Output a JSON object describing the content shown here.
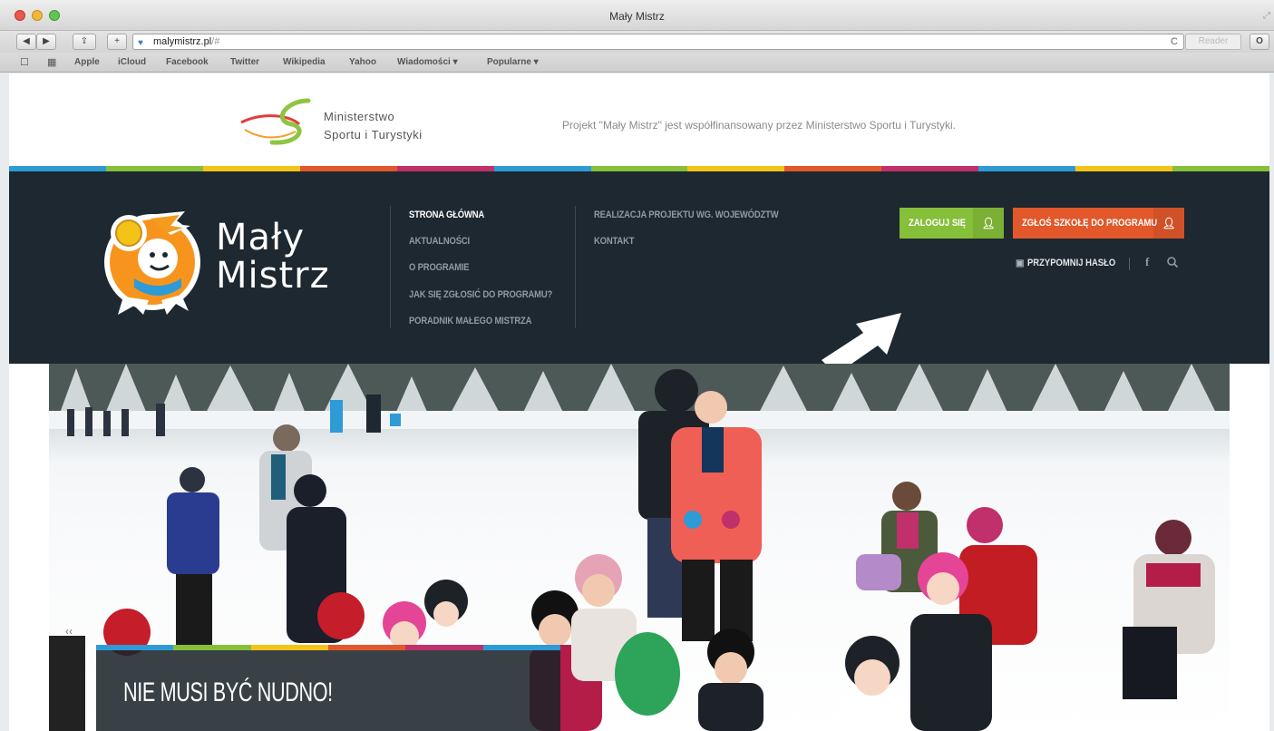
{
  "window": {
    "title": "Mały Mistrz"
  },
  "toolbar": {
    "url_host": "malymistrz.pl",
    "url_hash": "/#",
    "reload_glyph": "C",
    "reader_label": "Reader"
  },
  "bookmarks": [
    "Apple",
    "iCloud",
    "Facebook",
    "Twitter",
    "Wikipedia",
    "Yahoo",
    "Wiadomości ▾",
    "Popularne ▾"
  ],
  "sponsor": {
    "ministry_line1": "Ministerstwo",
    "ministry_line2": "Sportu i Turystyki",
    "cofund_text": "Projekt \"Mały Mistrz\" jest współfinansowany przez Ministerstwo Sportu i Turystyki."
  },
  "brand": {
    "line1": "Mały",
    "line2": "Mistrz"
  },
  "nav": {
    "col1": [
      "Strona główna",
      "Aktualności",
      "O programie",
      "Jak się zgłosić do programu?",
      "Poradnik Małego Mistrza"
    ],
    "col2": [
      "Realizacja projektu wg. województw",
      "Kontakt"
    ],
    "active_index": 0
  },
  "actions": {
    "login_label": "ZALOGUJ SIĘ",
    "join_label": "ZGŁOŚ SZKOŁĘ DO PROGRAMU",
    "remind_label": "PRZYPOMNIJ HASŁO",
    "facebook_glyph": "f"
  },
  "hero": {
    "caption_title": "NIE MUSI BYĆ NUDNO!",
    "pager_text": "‹‹"
  },
  "colors": {
    "navbar_bg": "#1d2830",
    "login_green": "#86bf3a",
    "join_orange": "#e2582b",
    "stripe": [
      "#2e9bd6",
      "#86bf3a",
      "#f4c318",
      "#e2582b",
      "#c0306b",
      "#2e9bd6",
      "#86bf3a",
      "#f4c318",
      "#e2582b",
      "#c0306b",
      "#2e9bd6",
      "#f4c318",
      "#86bf3a"
    ]
  }
}
